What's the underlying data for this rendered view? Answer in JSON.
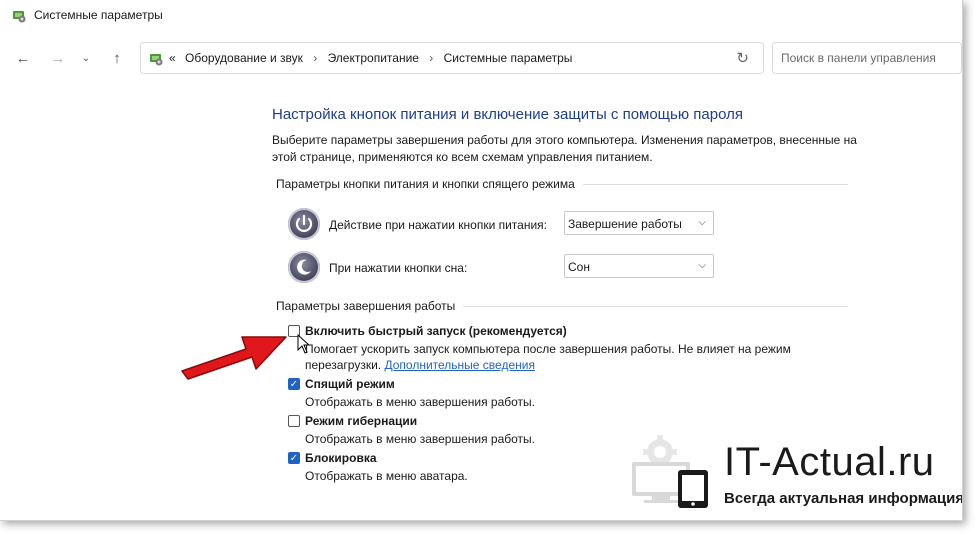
{
  "window": {
    "title": "Системные параметры",
    "icon": "control-panel-icon"
  },
  "nav": {
    "back_icon": "arrow-left-icon",
    "forward_icon": "arrow-right-icon",
    "recent_icon": "chevron-down-icon",
    "up_icon": "arrow-up-icon",
    "address_overflow": "«",
    "breadcrumbs": [
      "Оборудование и звук",
      "Электропитание",
      "Системные параметры"
    ],
    "separator": "›",
    "refresh_icon": "refresh-icon",
    "search_placeholder": "Поиск в панели управления"
  },
  "main": {
    "title": "Настройка кнопок питания и включение защиты с помощью пароля",
    "description": "Выберите параметры завершения работы для этого компьютера. Изменения параметров, внесенные на этой странице, применяются ко всем схемам управления питанием.",
    "buttons_section": {
      "header": "Параметры кнопки питания и кнопки спящего режима",
      "rows": [
        {
          "label": "Действие при нажатии кнопки питания:",
          "value": "Завершение работы",
          "icon": "power-button-icon"
        },
        {
          "label": "При нажатии кнопки сна:",
          "value": "Сон",
          "icon": "sleep-button-icon"
        }
      ]
    },
    "shutdown_section": {
      "header": "Параметры завершения работы",
      "options": [
        {
          "title": "Включить быстрый запуск (рекомендуется)",
          "desc": "Помогает ускорить запуск компьютера после завершения работы. Не влияет на режим перезагрузки.",
          "link": "Дополнительные сведения",
          "checked": false
        },
        {
          "title": "Спящий режим",
          "desc": "Отображать в меню завершения работы.",
          "checked": true
        },
        {
          "title": "Режим гибернации",
          "desc": "Отображать в меню завершения работы.",
          "checked": false
        },
        {
          "title": "Блокировка",
          "desc": "Отображать в меню аватара.",
          "checked": true
        }
      ]
    }
  },
  "watermark": {
    "title": "IT-Actual.ru",
    "subtitle": "Всегда актуальная информация"
  },
  "colors": {
    "title_blue": "#1e3e8f",
    "link_blue": "#1f63c7",
    "arrow_red": "#e0181b"
  }
}
